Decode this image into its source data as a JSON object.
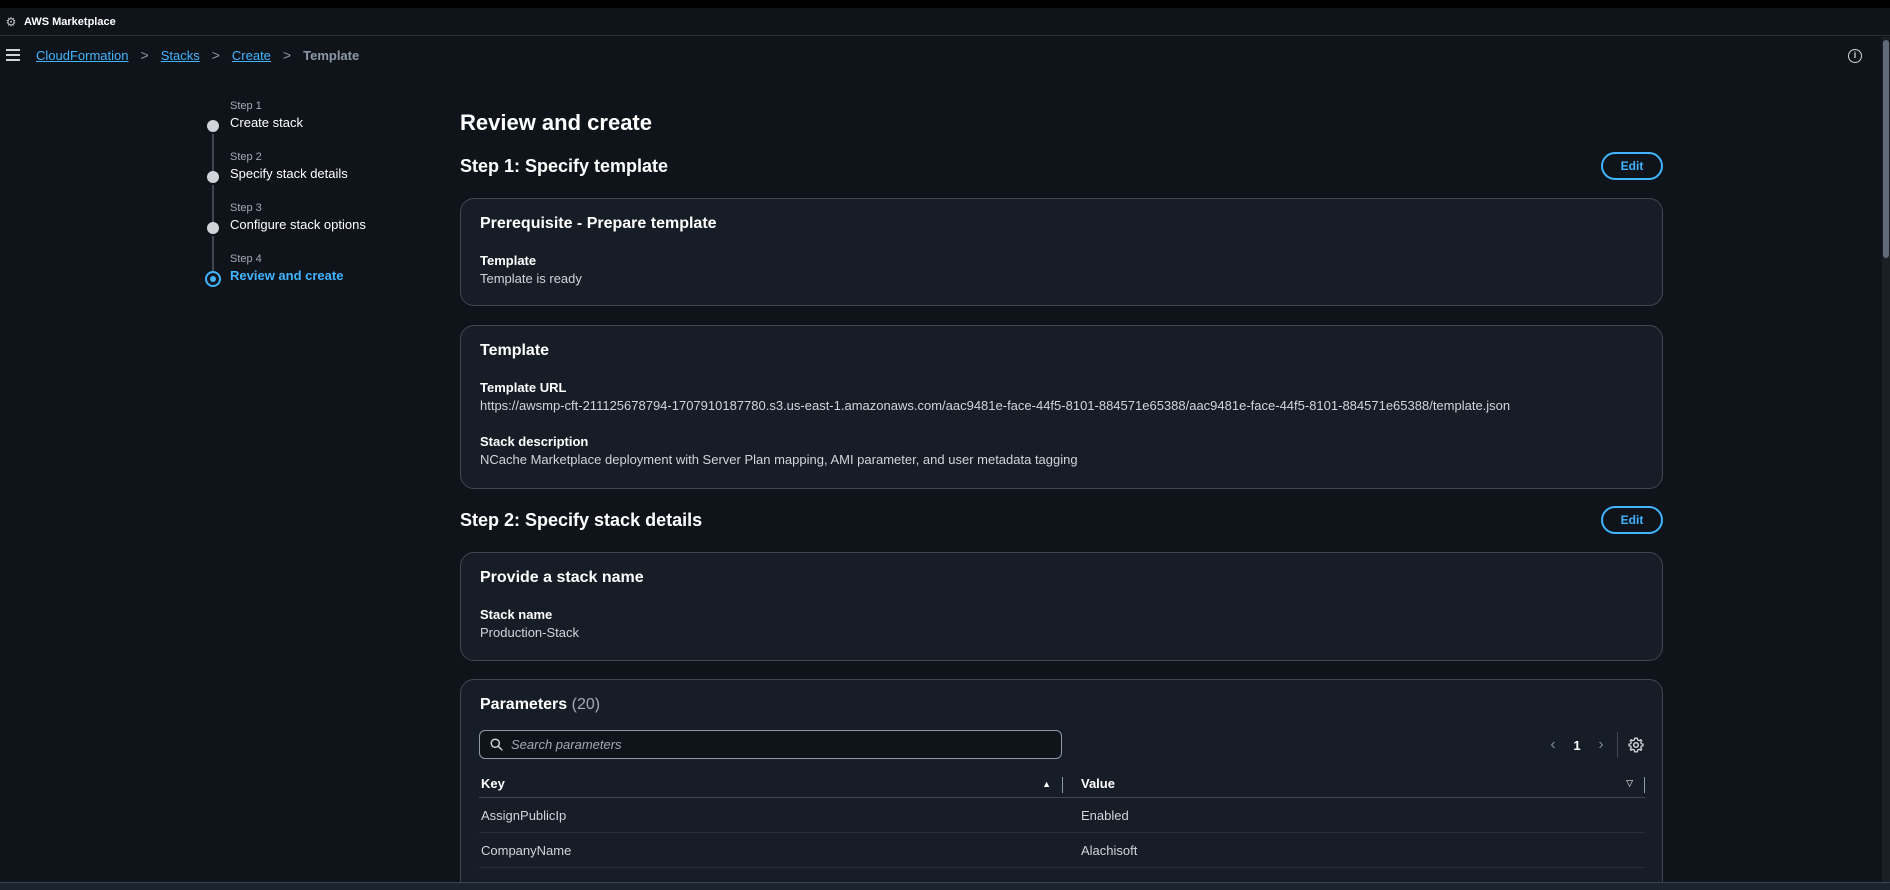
{
  "app": {
    "title": "AWS Marketplace"
  },
  "breadcrumb": {
    "items": [
      {
        "label": "CloudFormation"
      },
      {
        "label": "Stacks"
      },
      {
        "label": "Create"
      }
    ],
    "current": "Template",
    "separator": ">"
  },
  "wizard": {
    "steps": [
      {
        "number": "Step 1",
        "name": "Create stack"
      },
      {
        "number": "Step 2",
        "name": "Specify stack details"
      },
      {
        "number": "Step 3",
        "name": "Configure stack options"
      },
      {
        "number": "Step 4",
        "name": "Review and create"
      }
    ]
  },
  "page": {
    "title": "Review and create"
  },
  "step1": {
    "heading": "Step 1: Specify template",
    "edit_label": "Edit",
    "prereq": {
      "title": "Prerequisite - Prepare template",
      "label": "Template",
      "value": "Template is ready"
    },
    "template": {
      "title": "Template",
      "url_label": "Template URL",
      "url_value": "https://awsmp-cft-211125678794-1707910187780.s3.us-east-1.amazonaws.com/aac9481e-face-44f5-8101-884571e65388/aac9481e-face-44f5-8101-884571e65388/template.json",
      "desc_label": "Stack description",
      "desc_value": "NCache Marketplace deployment with Server Plan mapping, AMI parameter, and user metadata tagging"
    }
  },
  "step2": {
    "heading": "Step 2: Specify stack details",
    "edit_label": "Edit",
    "stack_name": {
      "title": "Provide a stack name",
      "label": "Stack name",
      "value": "Production-Stack"
    },
    "parameters": {
      "title": "Parameters",
      "count": "(20)",
      "search_placeholder": "Search parameters",
      "page": "1",
      "columns": {
        "key": "Key",
        "value": "Value"
      },
      "rows": [
        {
          "key": "AssignPublicIp",
          "value": "Enabled"
        },
        {
          "key": "CompanyName",
          "value": "Alachisoft"
        }
      ]
    }
  },
  "colors": {
    "background": "#0f141a",
    "card": "#161d26",
    "accent": "#42b4ff",
    "border": "#414750"
  },
  "icons": {
    "menu": "hamburger-icon",
    "info": "info-icon",
    "search": "search-icon",
    "settings": "gear-icon",
    "prev": "chevron-left-icon",
    "next": "chevron-right-icon"
  }
}
